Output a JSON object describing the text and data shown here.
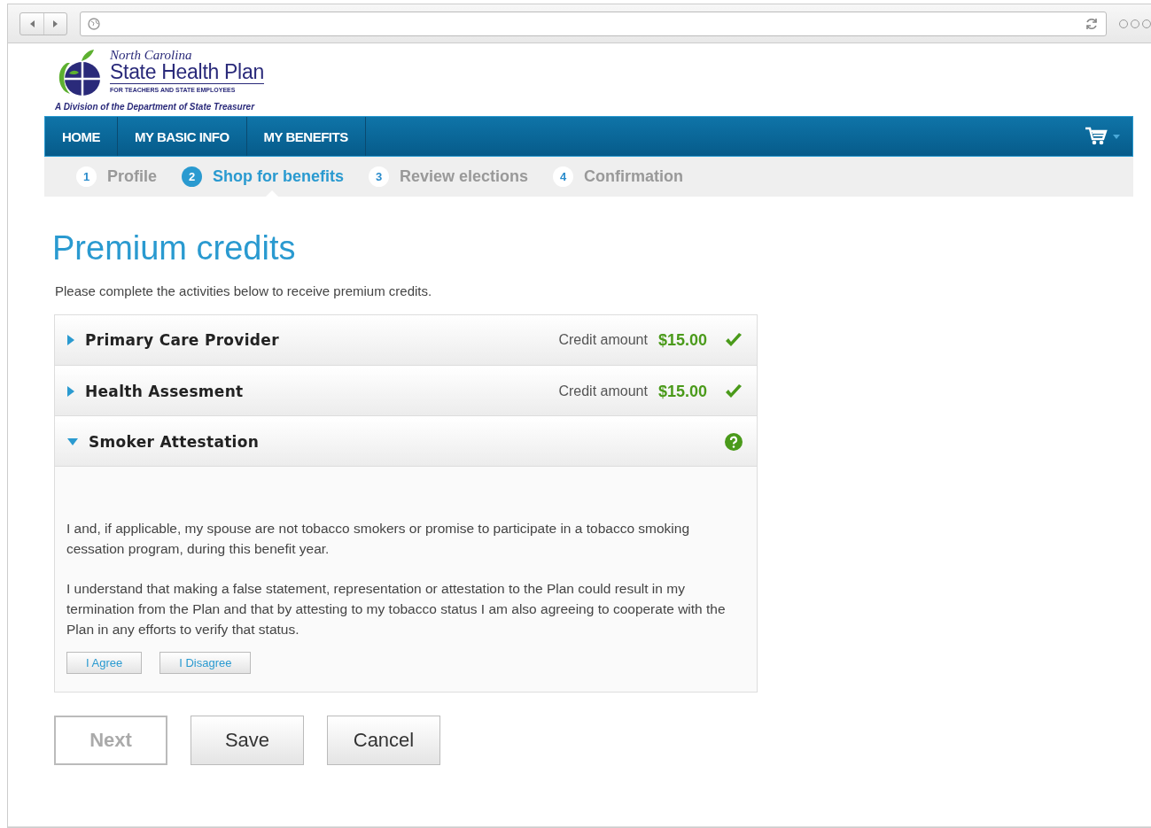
{
  "logo": {
    "script": "North Carolina",
    "name": "State Health Plan",
    "tagline": "FOR TEACHERS AND STATE EMPLOYEES",
    "division": "A Division of the Department of State Treasurer"
  },
  "nav": [
    {
      "label": "HOME"
    },
    {
      "label": "MY BASIC INFO"
    },
    {
      "label": "MY BENEFITS"
    }
  ],
  "steps": [
    {
      "number": "1",
      "label": "Profile",
      "selected": false
    },
    {
      "number": "2",
      "label": "Shop for benefits",
      "selected": true
    },
    {
      "number": "3",
      "label": "Review elections",
      "selected": false
    },
    {
      "number": "4",
      "label": "Confirmation",
      "selected": false
    }
  ],
  "title": "Premium credits",
  "intro": "Please complete the activities below to receive premium credits.",
  "sections": [
    {
      "title": "Primary Care Provider",
      "expanded": false,
      "kind": "completed",
      "credit_label": "Credit amount",
      "credit_amount": "$15.00"
    },
    {
      "title": "Health Assesment",
      "expanded": false,
      "kind": "completed",
      "credit_label": "Credit amount",
      "credit_amount": "$15.00"
    },
    {
      "title": "Smoker Attestation",
      "expanded": true,
      "kind": "pending",
      "paragraphs": [
        "I and, if applicable, my spouse are not tobacco smokers or promise to participate in a tobacco smoking cessation program, during this benefit year.",
        "I understand that making a false statement, representation or attestation to the Plan could result in my termination from the Plan and that by attesting to my tobacco status I am also agreeing to cooperate with the Plan in any efforts to verify that status."
      ],
      "buttons": [
        "I Agree",
        "I Disagree"
      ]
    }
  ],
  "actions": [
    {
      "label": "Next",
      "disabled": true
    },
    {
      "label": "Save",
      "disabled": false
    },
    {
      "label": "Cancel",
      "disabled": false
    }
  ]
}
